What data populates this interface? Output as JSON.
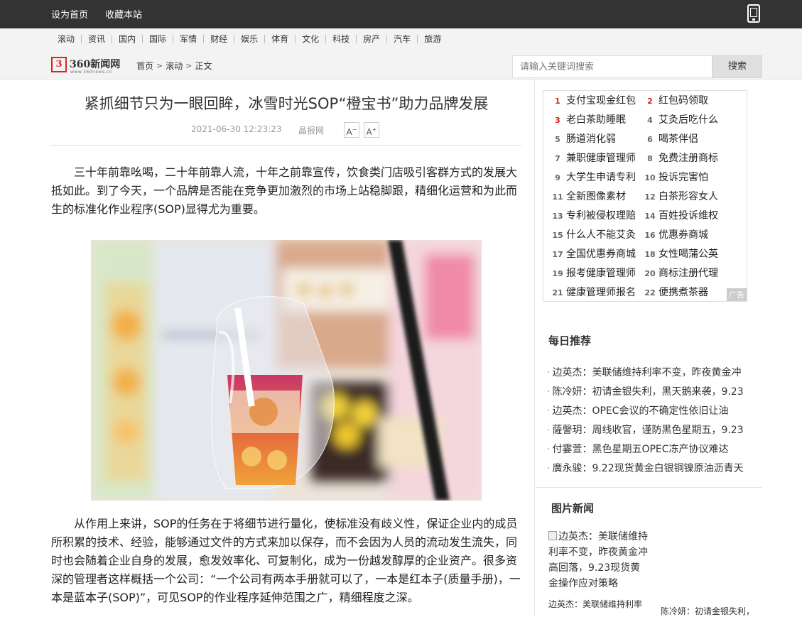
{
  "topbar": {
    "set_home": "设为首页",
    "bookmark": "收藏本站"
  },
  "nav": [
    "滚动",
    "资讯",
    "国内",
    "国际",
    "军情",
    "财经",
    "娱乐",
    "体育",
    "文化",
    "科技",
    "房产",
    "汽车",
    "旅游"
  ],
  "logo": {
    "name": "360新闻网",
    "url_text": "www.360news.cn"
  },
  "breadcrumb": [
    "首页",
    "滚动",
    "正文"
  ],
  "search": {
    "placeholder": "请输入关键词搜索",
    "button": "搜索"
  },
  "article": {
    "title": "紧抓细节只为一眼回眸，冰雪时光SOP“橙宝书”助力品牌发展",
    "date": "2021-06-30 12:23:23",
    "source": "晶报网",
    "font_down": "A",
    "font_up": "A",
    "para1": "三十年前靠吆喝，二十年前靠人流，十年之前靠宣传，饮食类门店吸引客群方式的发展大抵如此。到了今天，一个品牌是否能在竞争更加激烈的市场上站稳脚跟，精细化运营和为此而生的标准化作业程序(SOP)显得尤为重要。",
    "para2": "从作用上来讲，SOP的任务在于将细节进行量化，使标准没有歧义性，保证企业内的成员所积累的技术、经验，能够通过文件的方式来加以保存，而不会因为人员的流动发生流失，同时也会随着企业自身的发展，愈发效率化、可复制化，成为一份越发醇厚的企业资产。很多资深的管理者这样概括一个公司：“一个公司有两本手册就可以了，一本是红本子(质量手册)，一本是蓝本子(SOP)”，可见SOP的作业程序延伸范围之广，精细程度之深。"
  },
  "hot_keywords": [
    {
      "n": "1",
      "text": "支付宝现金红包"
    },
    {
      "n": "2",
      "text": "红包码领取"
    },
    {
      "n": "3",
      "text": "老白茶助睡眠"
    },
    {
      "n": "4",
      "text": "艾灸后吃什么"
    },
    {
      "n": "5",
      "text": "肠道消化弱"
    },
    {
      "n": "6",
      "text": "喝茶伴侣"
    },
    {
      "n": "7",
      "text": "兼职健康管理师"
    },
    {
      "n": "8",
      "text": "免费注册商标"
    },
    {
      "n": "9",
      "text": "大学生申请专利"
    },
    {
      "n": "10",
      "text": "投诉完害怕"
    },
    {
      "n": "11",
      "text": "全新图像素材"
    },
    {
      "n": "12",
      "text": "白茶形容女人"
    },
    {
      "n": "13",
      "text": "专利被侵权理赔"
    },
    {
      "n": "14",
      "text": "百姓投诉维权"
    },
    {
      "n": "15",
      "text": "什么人不能艾灸"
    },
    {
      "n": "16",
      "text": "优惠券商城"
    },
    {
      "n": "17",
      "text": "全国优惠券商城"
    },
    {
      "n": "18",
      "text": "女性喝蒲公英"
    },
    {
      "n": "19",
      "text": "报考健康管理师"
    },
    {
      "n": "20",
      "text": "商标注册代理"
    },
    {
      "n": "21",
      "text": "健康管理师报名"
    },
    {
      "n": "22",
      "text": "便携煮茶器"
    }
  ],
  "ad_tag": "广告",
  "daily": {
    "title": "每日推荐",
    "items": [
      {
        "author": "边英杰",
        "text": "：美联储维持利率不变，昨夜黄金冲"
      },
      {
        "author": "陈冷妍",
        "text": "：初请金银失利，黑天鹅来袭，9.23"
      },
      {
        "author": "边英杰",
        "text": "：OPEC会议的不确定性依旧让油"
      },
      {
        "author": "薩謦玥",
        "text": "：周线收官，谨防黑色星期五，9.23"
      },
      {
        "author": "付霎萱",
        "text": "：黑色星期五OPEC冻产协议难达"
      },
      {
        "author": "廣永骏",
        "text": "：9.22现货黄金白银铜镍原油沥青天"
      }
    ]
  },
  "pic_news": {
    "title": "图片新闻",
    "img_alt": "边英杰：美联储维持利率不变，昨夜黄金冲高回落，9.23现货黄金操作应对策略",
    "cap1": "边英杰：美联储维持利率",
    "cap2": "陈冷妍：初请金银失利，"
  }
}
